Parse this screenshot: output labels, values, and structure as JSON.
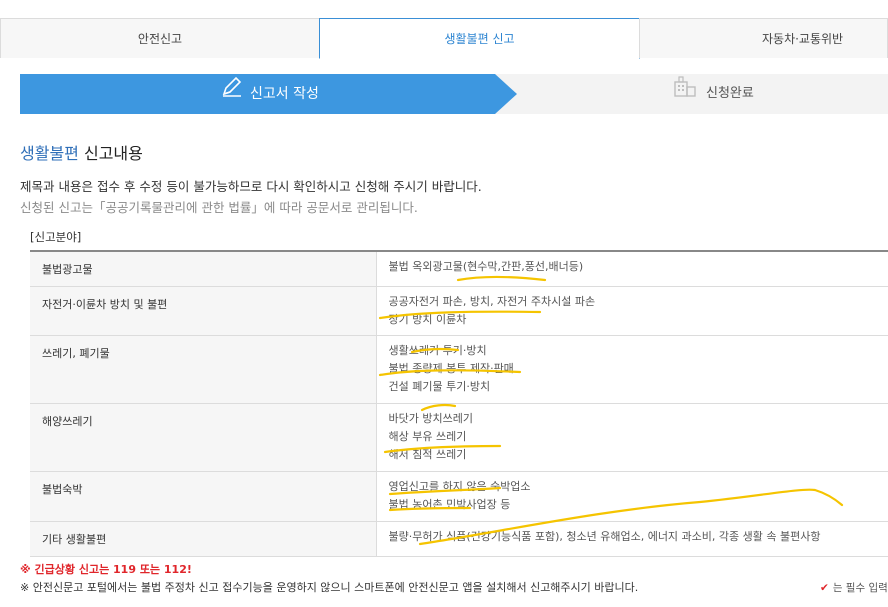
{
  "tabs": [
    {
      "label": "안전신고",
      "active": false
    },
    {
      "label": "생활불편 신고",
      "active": true
    },
    {
      "label": "자동차·교통위반",
      "active": false
    }
  ],
  "steps": {
    "current": "신고서 작성",
    "next": "신청완료",
    "current_icon": "pencil-icon",
    "next_icon": "building-icon"
  },
  "section": {
    "title_accent": "생활불편",
    "title_rest": " 신고내용",
    "notice": "제목과 내용은 접수 후 수정 등이 불가능하므로 다시 확인하시고 신청해 주시기 바랍니다.",
    "notice_sub": "신청된 신고는「공공기록물관리에 관한 법률」에 따라 공문서로 관리됩니다."
  },
  "field_label": "[신고분야]",
  "categories": [
    {
      "name": "불법광고물",
      "items": [
        "불법 옥외광고물(현수막,간판,풍선,배너등)"
      ]
    },
    {
      "name": "자전거·이륜차 방치 및 불편",
      "items": [
        "공공자전거 파손, 방치, 자전거 주차시설 파손",
        "장기 방치 이륜차"
      ]
    },
    {
      "name": "쓰레기, 폐기물",
      "items": [
        "생활쓰레기 투기·방치",
        "불법 종량제 봉투 제작·판매",
        "건설 폐기물 투기·방치"
      ]
    },
    {
      "name": "해양쓰레기",
      "items": [
        "바닷가 방치쓰레기",
        "해상 부유 쓰레기",
        "해저 침적 쓰레기"
      ]
    },
    {
      "name": "불법숙박",
      "items": [
        "영업신고를 하지 않은 숙박업소",
        "불법 농어촌 민박사업장 등"
      ]
    },
    {
      "name": "기타 생활불편",
      "items": [
        "불량·무허가 식품(건강기능식품 포함), 청소년 유해업소, 에너지 과소비, 각종 생활 속 불편사항"
      ]
    }
  ],
  "footer": {
    "urgent": "※ 긴급상황 신고는 119 또는 112!",
    "portal_note": "※ 안전신문고 포털에서는 불법 주정차 신고 접수기능을 운영하지 않으니 스마트폰에 안전신문고 앱을 설치해서 신고해주시기 바랍니다.",
    "required_note": "는 필수 입력",
    "required_icon": "checkmark-icon"
  },
  "colors": {
    "accent": "#3d97e0",
    "highlight": "#f5c400",
    "urgent": "#e0262b"
  }
}
